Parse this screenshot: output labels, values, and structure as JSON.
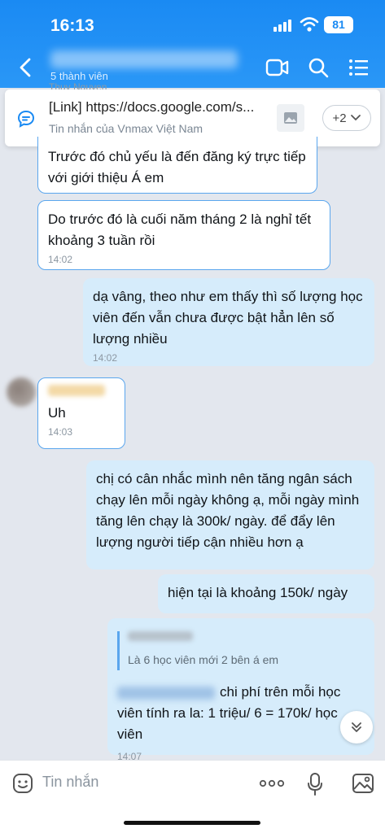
{
  "status_bar": {
    "time": "16:13",
    "battery": "81"
  },
  "header": {
    "subtitle": "5 thành viên"
  },
  "pinned": {
    "peek_sender": "Thuy Nguyen",
    "link": "[Link] https://docs.google.com/s...",
    "source": "Tin nhắn của Vnmax Việt Nam",
    "more_count": "+2"
  },
  "messages": [
    {
      "text": "Trước đó chủ yếu là đến đăng ký trực tiếp với giới thiệu Á em"
    },
    {
      "text": "Do trước đó là cuối năm tháng 2 là nghỉ tết khoảng 3 tuần rồi",
      "time": "14:02"
    },
    {
      "text": "dạ vâng, theo như em thấy thì số lượng học viên đến vẫn chưa được bật hẳn lên số lượng nhiều",
      "time": "14:02"
    },
    {
      "text": "Uh",
      "time": "14:03"
    },
    {
      "text": "chị có cân nhắc mình nên tăng ngân sách chạy lên mỗi ngày không ạ, mỗi ngày mình tăng lên chạy là 300k/ ngày. để đẩy lên lượng người tiếp cận nhiều hơn ạ"
    },
    {
      "text": "hiện tại là khoảng 150k/ ngày"
    },
    {
      "quote": "Là 6 học viên mới 2 bên á  em",
      "text": "chi phí trên mỗi học viên tính ra la: 1 triệu/ 6 = 170k/ học viên",
      "time": "14:07"
    }
  ],
  "composer": {
    "placeholder": "Tin nhắn"
  },
  "colors": {
    "header": "#1a8af3",
    "outgoing": "#d6ecfb",
    "incoming_border": "#5aa6ee"
  }
}
